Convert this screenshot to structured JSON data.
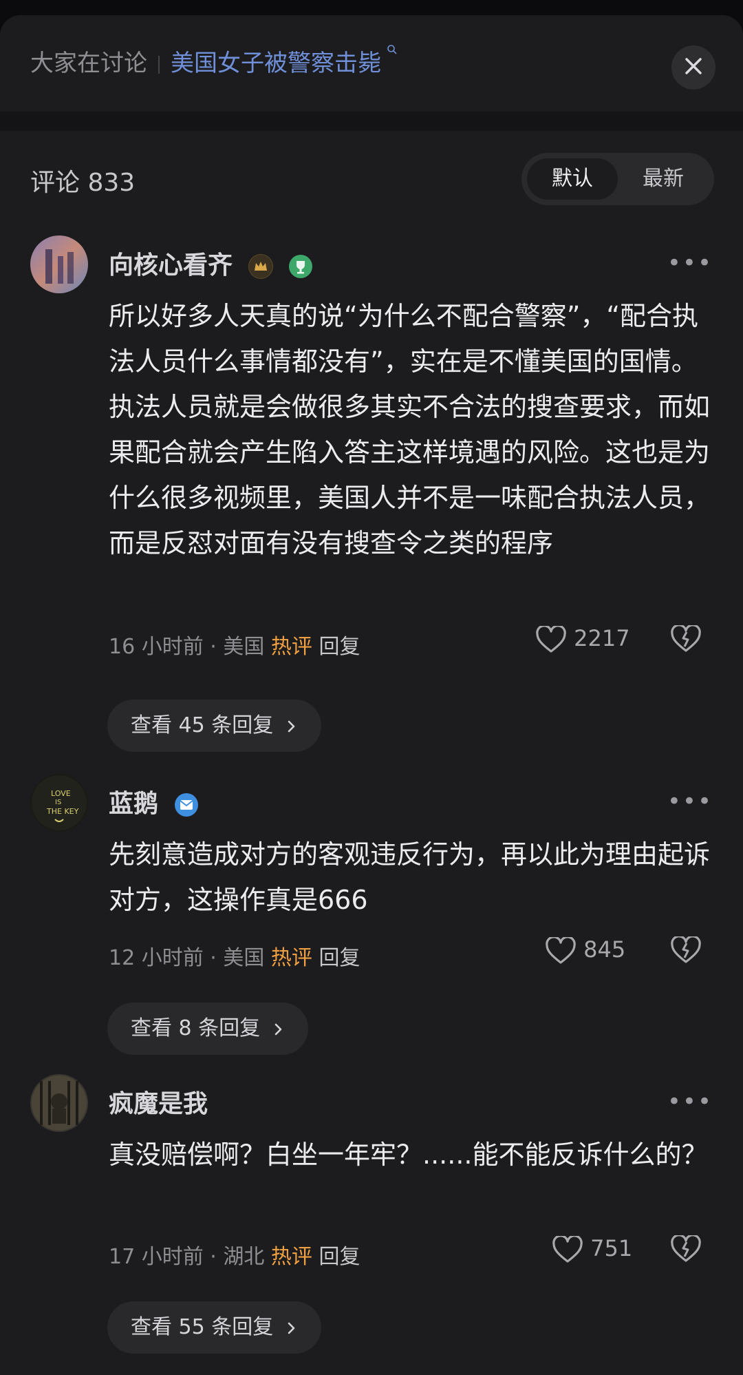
{
  "header": {
    "label": "大家在讨论",
    "topic": "美国女子被警察击毙"
  },
  "comments_count": "评论 833",
  "sort": {
    "default": "默认",
    "latest": "最新"
  },
  "comments": [
    {
      "user": "向核心看齐",
      "text": "所以好多人天真的说“为什么不配合警察”，“配合执法人员什么事情都没有”，实在是不懂美国的国情。执法人员就是会做很多其实不合法的搜查要求，而如果配合就会产生陷入答主这样境遇的风险。这也是为什么很多视频里，美国人并不是一味配合执法人员，而是反怼对面有没有搜查令之类的程序",
      "time": "16 小时前",
      "dot": "·",
      "location": "美国",
      "hot": "热评",
      "reply": "回复",
      "likes": "2217",
      "expand": "查看 45 条回复"
    },
    {
      "user": "蓝鹅",
      "text": "先刻意造成对方的客观违反行为，再以此为理由起诉对方，这操作真是666",
      "time": "12 小时前",
      "dot": "·",
      "location": "美国",
      "hot": "热评",
      "reply": "回复",
      "likes": "845",
      "expand": "查看 8 条回复"
    },
    {
      "user": "疯魔是我",
      "text": "真没赔偿啊？白坐一年牢？......能不能反诉什么的？",
      "time": "17 小时前",
      "dot": "·",
      "location": "湖北",
      "hot": "热评",
      "reply": "回复",
      "likes": "751",
      "expand": "查看 55 条回复"
    }
  ],
  "colors": {
    "background": "#1c1c1e",
    "topic": "#6f90d8",
    "hot": "#f0a040",
    "text": "#ececee",
    "meta": "#8e8e93"
  },
  "icons": [
    "close-icon",
    "more-icon",
    "heart-icon",
    "dislike-icon",
    "chevron-right-icon",
    "search-icon"
  ]
}
